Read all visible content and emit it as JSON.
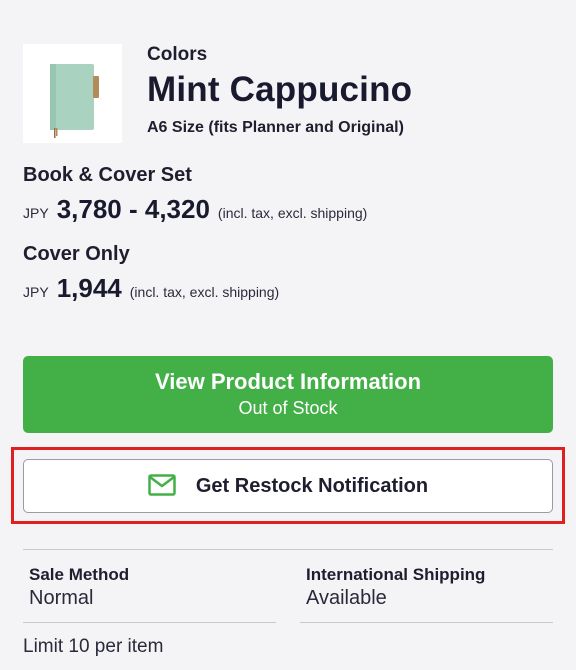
{
  "product": {
    "thumbnail_icon": "mint-notebook-cover-image",
    "colors_label": "Colors",
    "name": "Mint Cappucino",
    "size": "A6 Size (fits Planner and Original)"
  },
  "pricing": {
    "set": {
      "title": "Book & Cover Set",
      "currency": "JPY",
      "amount": "3,780 - 4,320",
      "tax_note": "(incl. tax, excl. shipping)"
    },
    "cover": {
      "title": "Cover Only",
      "currency": "JPY",
      "amount": "1,944",
      "tax_note": "(incl. tax, excl. shipping)"
    }
  },
  "actions": {
    "view_label": "View Product Information",
    "view_sublabel": "Out of Stock",
    "restock_label": "Get Restock Notification",
    "restock_icon": "mail-icon"
  },
  "details": {
    "sale_method_label": "Sale Method",
    "sale_method_value": "Normal",
    "shipping_label": "International Shipping",
    "shipping_value": "Available",
    "limit_text": "Limit 10 per item"
  },
  "colors": {
    "accent_green": "#43b047",
    "highlight_red": "#e02020",
    "cover_mint": "#a9d3c0"
  }
}
